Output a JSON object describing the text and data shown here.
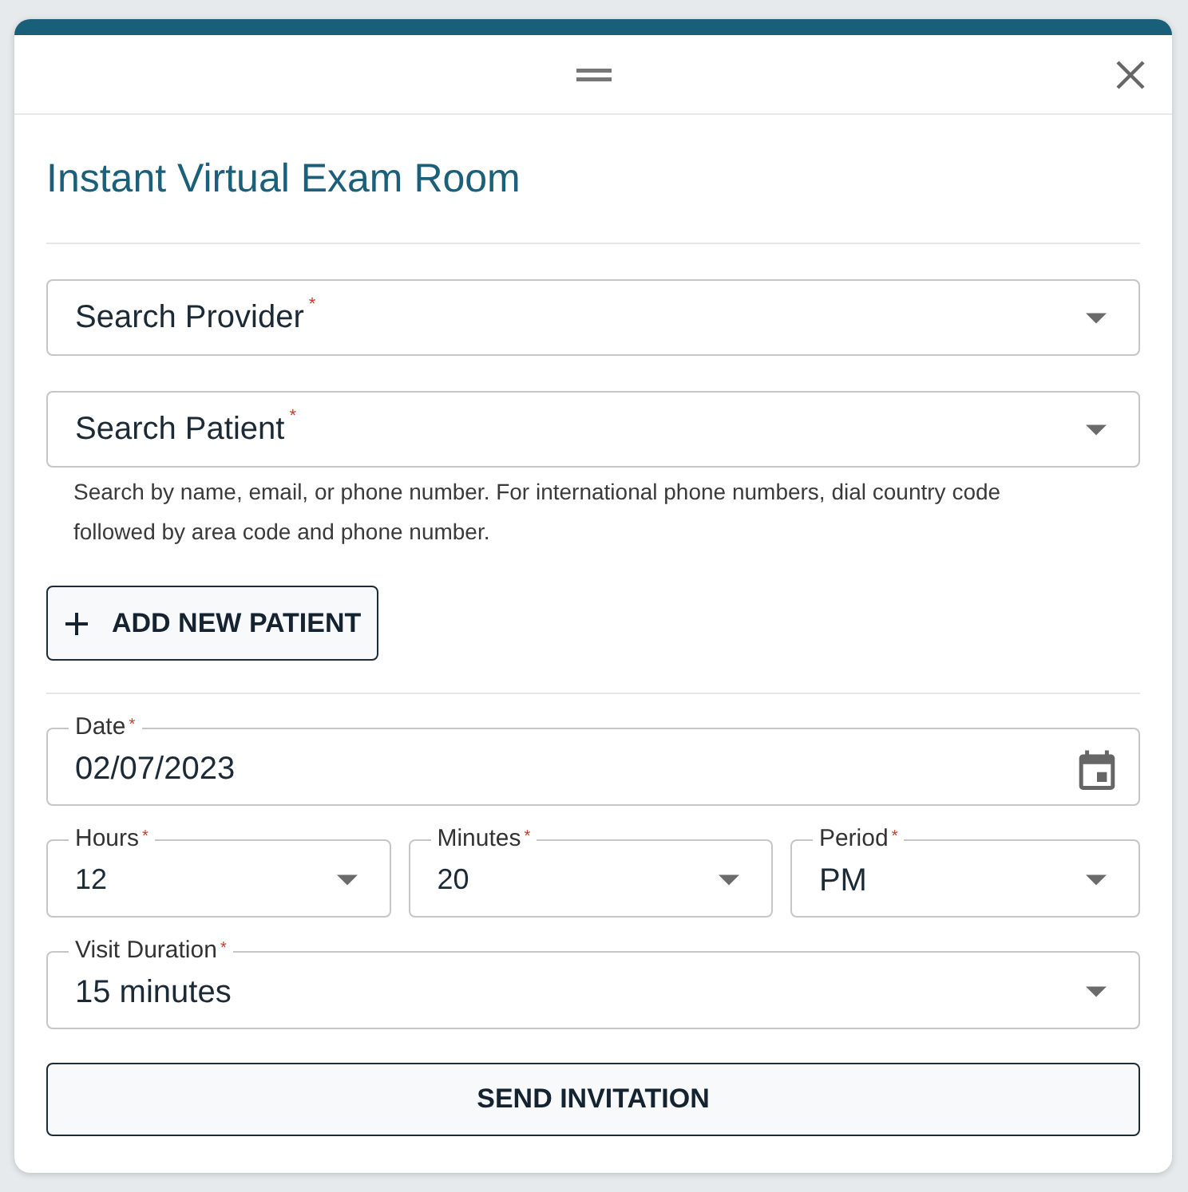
{
  "dialog": {
    "title": "Instant Virtual Exam Room"
  },
  "patient_section": {
    "fields": [
      {
        "kind": "search",
        "label": "Search Provider",
        "required_mark": "*"
      },
      {
        "kind": "search",
        "label": "Search Patient",
        "required_mark": "*",
        "helper_text": "Search by name, email, or phone number. For international phone numbers, dial country code followed by area code and phone number."
      }
    ],
    "add_button": {
      "label": "ADD NEW PATIENT"
    }
  },
  "schedule_section": {
    "date_field": {
      "kind": "date",
      "label": "Date",
      "required_mark": "*",
      "value": "02/07/2023"
    },
    "time_fields": [
      {
        "kind": "select",
        "label": "Hours",
        "required_mark": "*",
        "value": "12"
      },
      {
        "kind": "select",
        "label": "Minutes",
        "required_mark": "*",
        "value": "20"
      },
      {
        "kind": "select",
        "label": "Period",
        "required_mark": "*",
        "value": "PM"
      }
    ],
    "duration_field": {
      "kind": "select",
      "label": "Visit Duration",
      "required_mark": "*",
      "value": "15 minutes"
    },
    "submit_button": {
      "label": "SEND INVITATION"
    }
  }
}
